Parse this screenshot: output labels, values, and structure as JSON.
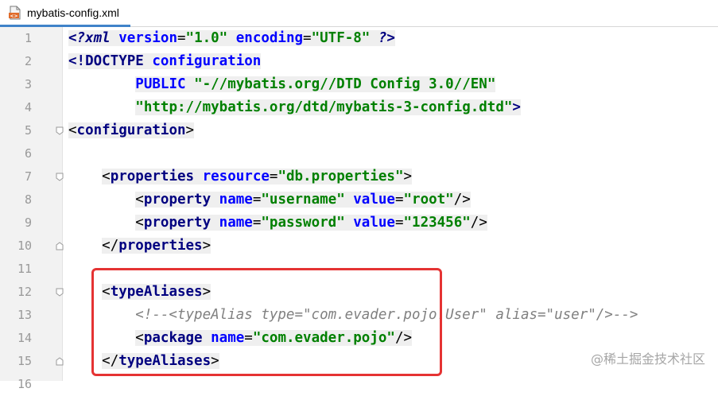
{
  "tab": {
    "title": "mybatis-config.xml",
    "icon": "xml-file-icon"
  },
  "lines": [
    {
      "n": "1",
      "segs": [
        [
          "pi",
          "<?xml"
        ],
        [
          "attr",
          " version"
        ],
        [
          "punct",
          "="
        ],
        [
          "str",
          "\"1.0\""
        ],
        [
          "attr",
          " encoding"
        ],
        [
          "punct",
          "="
        ],
        [
          "str",
          "\"UTF-8\""
        ],
        [
          "pi",
          " ?>"
        ]
      ]
    },
    {
      "n": "2",
      "segs": [
        [
          "tag",
          "<!DOCTYPE "
        ],
        [
          "attr",
          "configuration"
        ]
      ]
    },
    {
      "n": "3",
      "segs": [
        [
          "attr",
          "        PUBLIC "
        ],
        [
          "str",
          "\"-//mybatis.org//DTD Config 3.0//EN\""
        ]
      ]
    },
    {
      "n": "4",
      "segs": [
        [
          "str",
          "        \"http://mybatis.org/dtd/mybatis-3-config.dtd\""
        ],
        [
          "tag",
          ">"
        ]
      ]
    },
    {
      "n": "5",
      "segs": [
        [
          "punct",
          "<"
        ],
        [
          "tag",
          "configuration"
        ],
        [
          "punct",
          ">"
        ]
      ]
    },
    {
      "n": "6",
      "segs": []
    },
    {
      "n": "7",
      "segs": [
        [
          "punct",
          "    <"
        ],
        [
          "tag",
          "properties"
        ],
        [
          "attr",
          " resource"
        ],
        [
          "punct",
          "="
        ],
        [
          "str",
          "\"db.properties\""
        ],
        [
          "punct",
          ">"
        ]
      ]
    },
    {
      "n": "8",
      "segs": [
        [
          "punct",
          "        <"
        ],
        [
          "tag",
          "property"
        ],
        [
          "attr",
          " name"
        ],
        [
          "punct",
          "="
        ],
        [
          "str",
          "\"username\""
        ],
        [
          "attr",
          " value"
        ],
        [
          "punct",
          "="
        ],
        [
          "str",
          "\"root\""
        ],
        [
          "punct",
          "/>"
        ]
      ]
    },
    {
      "n": "9",
      "segs": [
        [
          "punct",
          "        <"
        ],
        [
          "tag",
          "property"
        ],
        [
          "attr",
          " name"
        ],
        [
          "punct",
          "="
        ],
        [
          "str",
          "\"password\""
        ],
        [
          "attr",
          " value"
        ],
        [
          "punct",
          "="
        ],
        [
          "str",
          "\"123456\""
        ],
        [
          "punct",
          "/>"
        ]
      ]
    },
    {
      "n": "10",
      "segs": [
        [
          "punct",
          "    </"
        ],
        [
          "tag",
          "properties"
        ],
        [
          "punct",
          ">"
        ]
      ]
    },
    {
      "n": "11",
      "segs": []
    },
    {
      "n": "12",
      "segs": [
        [
          "punct",
          "    <"
        ],
        [
          "tag",
          "typeAliases"
        ],
        [
          "punct",
          ">"
        ]
      ]
    },
    {
      "n": "13",
      "segs": [
        [
          "cmt",
          "        <!--<typeAlias type=\"com.evader.pojo.User\" alias=\"user\"/>-->"
        ]
      ]
    },
    {
      "n": "14",
      "segs": [
        [
          "punct",
          "        <"
        ],
        [
          "tag",
          "package"
        ],
        [
          "attr",
          " name"
        ],
        [
          "punct",
          "="
        ],
        [
          "str",
          "\"com.evader.pojo\""
        ],
        [
          "punct",
          "/>"
        ]
      ]
    },
    {
      "n": "15",
      "segs": [
        [
          "punct",
          "    </"
        ],
        [
          "tag",
          "typeAliases"
        ],
        [
          "punct",
          ">"
        ]
      ]
    },
    {
      "n": "16",
      "segs": []
    }
  ],
  "watermark": "@稀土掘金技术社区",
  "colors": {
    "highlight_box": "#e53333",
    "tab_underline": "#4083c9",
    "tag": "#000080",
    "attr": "#0000ff",
    "string": "#008000",
    "comment": "#808080"
  }
}
